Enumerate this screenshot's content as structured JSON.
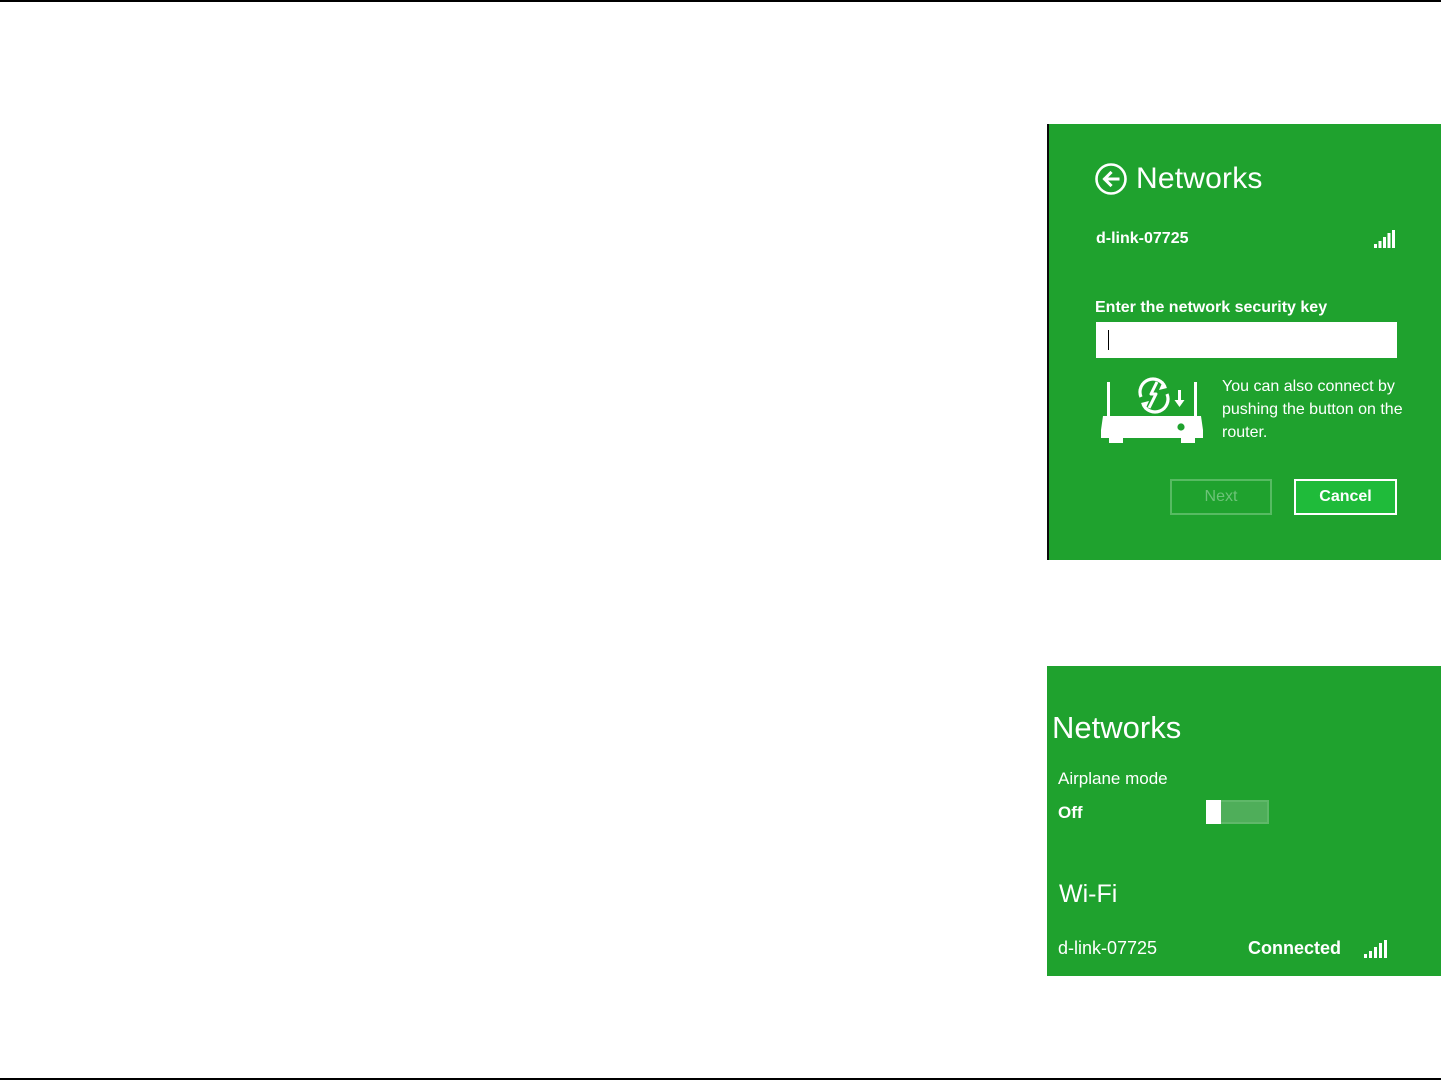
{
  "key_panel": {
    "title": "Networks",
    "back_icon": "back-arrow-circle-icon",
    "network_name": "d-link-07725",
    "signal_icon": "wifi-signal-bars-icon",
    "key_label": "Enter the network security key",
    "key_input": {
      "value": "",
      "placeholder": ""
    },
    "router_icon": "router-wps-icon",
    "hint": "You can also connect by pushing the button on the router.",
    "next_label": "Next",
    "cancel_label": "Cancel"
  },
  "networks_panel": {
    "title": "Networks",
    "airplane_label": "Airplane mode",
    "airplane_state": "Off",
    "wifi_heading": "Wi-Fi",
    "network_name": "d-link-07725",
    "status": "Connected",
    "signal_icon": "wifi-signal-bars-icon"
  },
  "colors": {
    "panel_bg": "#1fa22e",
    "cancel_bg": "#1fbb3a",
    "disabled_border": "#57bb62",
    "text": "#ffffff"
  }
}
